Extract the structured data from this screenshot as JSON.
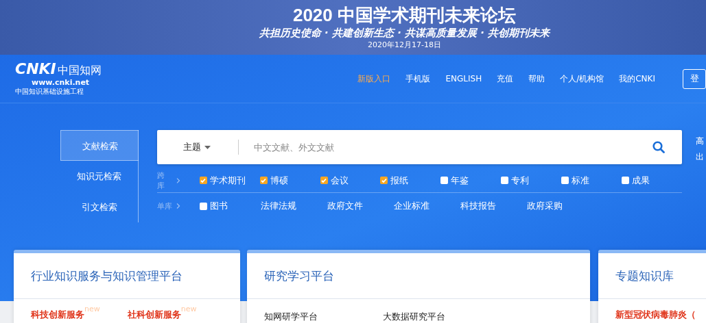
{
  "banner": {
    "title": "2020 中国学术期刊未来论坛",
    "slogan": "共担历史使命 · 共建创新生态 · 共谋高质量发展 · 共创期刊未来",
    "date": "2020年12月17-18日"
  },
  "logo": {
    "mark": "CNKI",
    "name": "中国知网",
    "url": "www.cnki.net",
    "tagline": "中国知识基础设施工程"
  },
  "nav": [
    {
      "label": "新版入口",
      "highlight": true
    },
    {
      "label": "手机版",
      "highlight": false
    },
    {
      "label": "ENGLISH",
      "highlight": false
    },
    {
      "label": "充值",
      "highlight": false
    },
    {
      "label": "帮助",
      "highlight": false
    },
    {
      "label": "个人/机构馆",
      "highlight": false
    },
    {
      "label": "我的CNKI",
      "highlight": false
    }
  ],
  "login": "登",
  "search_tabs": [
    {
      "label": "文献检索",
      "selected": true
    },
    {
      "label": "知识元检索",
      "selected": false
    },
    {
      "label": "引文检索",
      "selected": false
    }
  ],
  "search": {
    "scope": "主题",
    "placeholder": "中文文献、外文文献"
  },
  "side_links": [
    "高",
    "出"
  ],
  "cross_db": {
    "label": "跨库",
    "items": [
      {
        "label": "学术期刊",
        "checked": true
      },
      {
        "label": "博硕",
        "checked": true
      },
      {
        "label": "会议",
        "checked": true
      },
      {
        "label": "报纸",
        "checked": true
      },
      {
        "label": "年鉴",
        "checked": false
      },
      {
        "label": "专利",
        "checked": false
      },
      {
        "label": "标准",
        "checked": false
      },
      {
        "label": "成果",
        "checked": false
      }
    ]
  },
  "single_db": {
    "label": "单库",
    "items": [
      {
        "kind": "checkbox",
        "label": "图书",
        "checked": false
      },
      {
        "kind": "link",
        "label": "法律法规"
      },
      {
        "kind": "link",
        "label": "政府文件"
      },
      {
        "kind": "link",
        "label": "企业标准"
      },
      {
        "kind": "link",
        "label": "科技报告"
      },
      {
        "kind": "link",
        "label": "政府采购"
      }
    ]
  },
  "cards": [
    {
      "title": "行业知识服务与知识管理平台",
      "links": [
        {
          "label": "科技创新服务",
          "badge": "new",
          "hot": true
        },
        {
          "label": "社科创新服务",
          "badge": "new",
          "hot": true
        }
      ]
    },
    {
      "title": "研究学习平台",
      "links": [
        {
          "label": "知网研学平台",
          "hot": false
        },
        {
          "label": "大数据研究平台",
          "hot": false
        }
      ]
    },
    {
      "title": "专题知识库",
      "links": [
        {
          "label": "新型冠状病毒肺炎（",
          "hot": true
        }
      ]
    }
  ]
}
